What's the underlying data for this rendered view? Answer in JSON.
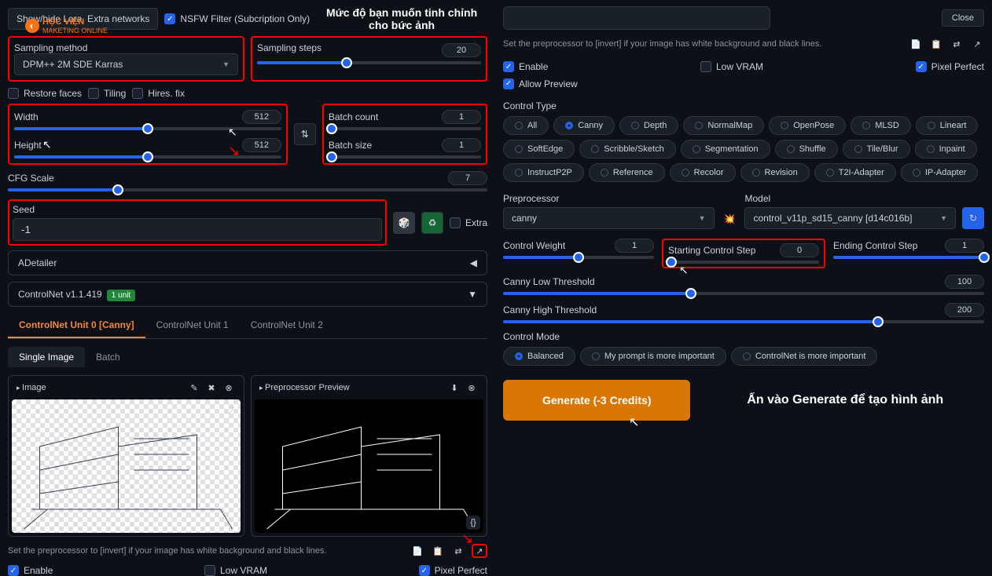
{
  "header": {
    "show_hide_lora": "Show/hide Lora, Extra networks",
    "nsfw_filter": "NSFW Filter (Subcription Only)",
    "close": "Close"
  },
  "annotations": {
    "top": "Mức độ bạn muốn tinh chỉnh cho bức ảnh",
    "generate": "Ấn vào Generate để tạo hình ảnh"
  },
  "logo": {
    "line1": "HỌC VIỆN",
    "line2": "MAKETING ONLINE"
  },
  "sampling": {
    "method_label": "Sampling method",
    "method_value": "DPM++ 2M SDE Karras",
    "steps_label": "Sampling steps",
    "steps_value": "20"
  },
  "checks": {
    "restore_faces": "Restore faces",
    "tiling": "Tiling",
    "hires_fix": "Hires. fix"
  },
  "size": {
    "width_label": "Width",
    "width_value": "512",
    "height_label": "Height",
    "height_value": "512"
  },
  "batch": {
    "count_label": "Batch count",
    "count_value": "1",
    "size_label": "Batch size",
    "size_value": "1"
  },
  "cfg": {
    "label": "CFG Scale",
    "value": "7"
  },
  "seed": {
    "label": "Seed",
    "value": "-1",
    "extra": "Extra"
  },
  "adetailer": {
    "label": "ADetailer"
  },
  "controlnet_panel": {
    "label": "ControlNet v1.1.419",
    "badge": "1 unit"
  },
  "cn_tabs": {
    "unit0": "ControlNet Unit 0 [Canny]",
    "unit1": "ControlNet Unit 1",
    "unit2": "ControlNet Unit 2"
  },
  "cn_subtabs": {
    "single": "Single Image",
    "batch": "Batch"
  },
  "img_panels": {
    "image": "Image",
    "preview": "Preprocessor Preview"
  },
  "preproc_note": "Set the preprocessor to [invert] if your image has white background and black lines.",
  "cn_checks": {
    "enable": "Enable",
    "low_vram": "Low VRAM",
    "pixel_perfect": "Pixel Perfect",
    "allow_preview": "Allow Preview"
  },
  "control_type": {
    "label": "Control Type",
    "all": "All",
    "canny": "Canny",
    "depth": "Depth",
    "normalmap": "NormalMap",
    "openpose": "OpenPose",
    "mlsd": "MLSD",
    "lineart": "Lineart",
    "softedge": "SoftEdge",
    "scribble": "Scribble/Sketch",
    "segmentation": "Segmentation",
    "shuffle": "Shuffle",
    "tileblur": "Tile/Blur",
    "inpaint": "Inpaint",
    "instructp2p": "InstructP2P",
    "reference": "Reference",
    "recolor": "Recolor",
    "revision": "Revision",
    "t2i": "T2I-Adapter",
    "ip": "IP-Adapter"
  },
  "preproc": {
    "label": "Preprocessor",
    "value": "canny",
    "model_label": "Model",
    "model_value": "control_v11p_sd15_canny [d14c016b]"
  },
  "cn_sliders": {
    "weight_label": "Control Weight",
    "weight_value": "1",
    "start_label": "Starting Control Step",
    "start_value": "0",
    "end_label": "Ending Control Step",
    "end_value": "1",
    "low_label": "Canny Low Threshold",
    "low_value": "100",
    "high_label": "Canny High Threshold",
    "high_value": "200"
  },
  "control_mode": {
    "label": "Control Mode",
    "balanced": "Balanced",
    "prompt": "My prompt is more important",
    "controlnet": "ControlNet is more important"
  },
  "generate": {
    "label": "Generate (-3 Credits)"
  }
}
